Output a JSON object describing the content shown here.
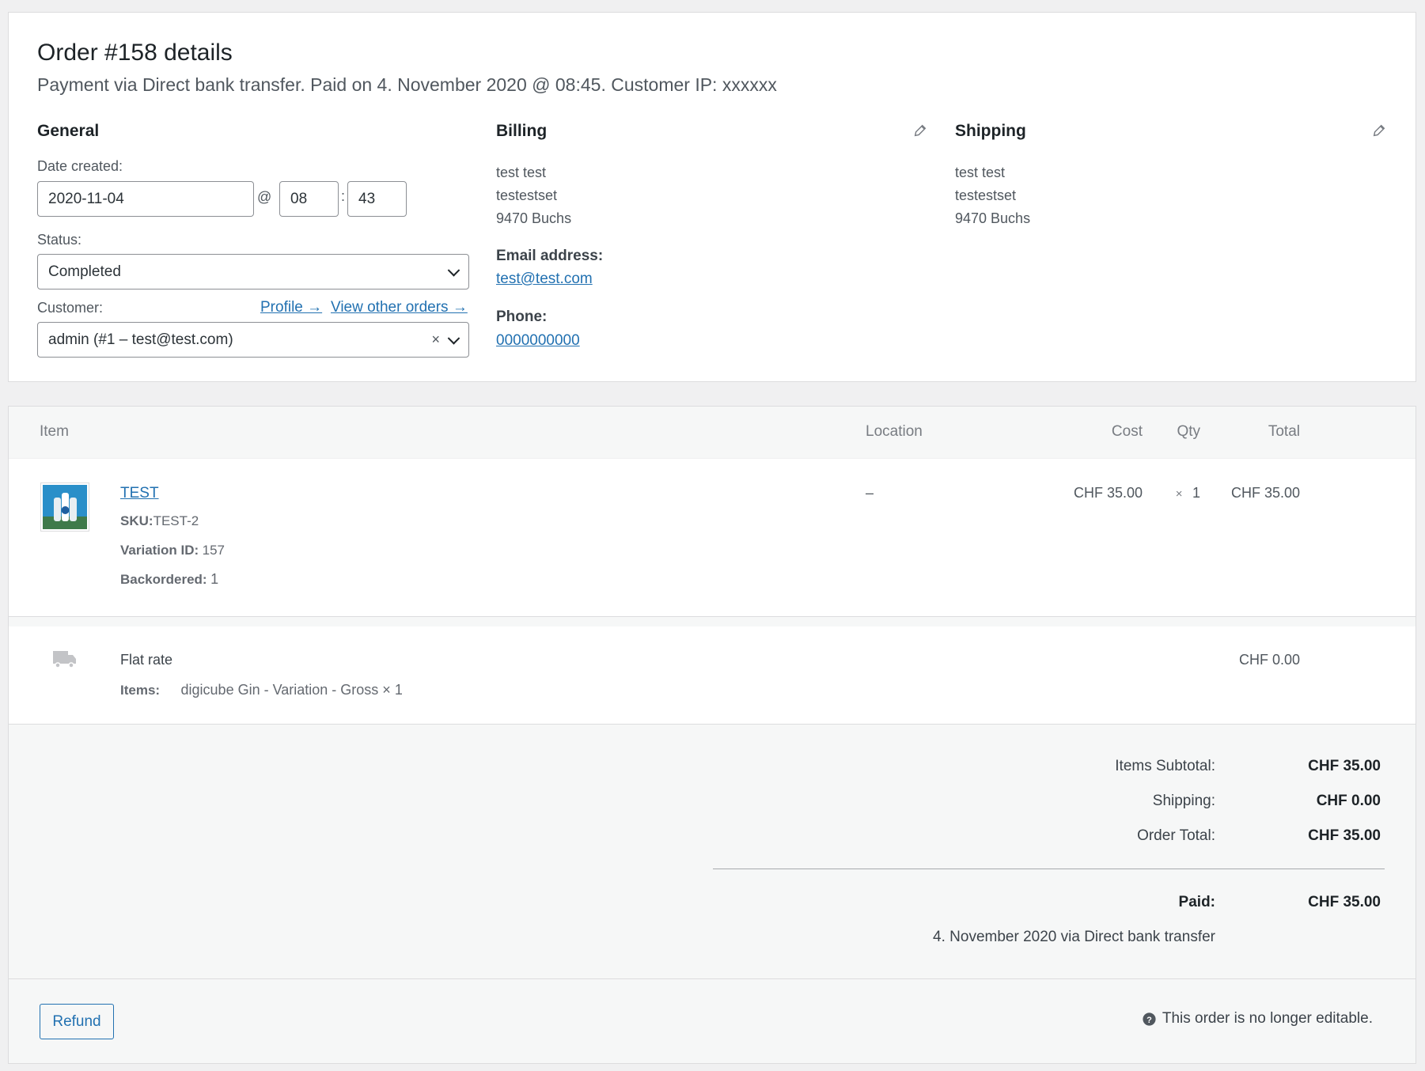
{
  "order": {
    "title": "Order #158 details",
    "subtitle": "Payment via Direct bank transfer. Paid on 4. November 2020 @ 08:45. Customer IP: xxxxxx"
  },
  "general": {
    "heading": "General",
    "date_label": "Date created:",
    "date_value": "2020-11-04",
    "at_sign": "@",
    "hour": "08",
    "colon": ":",
    "minute": "43",
    "status_label": "Status:",
    "status_value": "Completed",
    "customer_label": "Customer:",
    "profile_link": "Profile →",
    "other_orders_link": "View other orders →",
    "customer_value": "admin (#1 – test@test.com)",
    "clear_symbol": "×"
  },
  "billing": {
    "heading": "Billing",
    "line1": "test test",
    "line2": "testestset",
    "line3": "9470 Buchs",
    "email_label": "Email address:",
    "email": "test@test.com",
    "phone_label": "Phone:",
    "phone": "0000000000"
  },
  "shipping": {
    "heading": "Shipping",
    "line1": "test test",
    "line2": "testestset",
    "line3": "9470 Buchs"
  },
  "items_table": {
    "headers": {
      "item": "Item",
      "location": "Location",
      "cost": "Cost",
      "qty": "Qty",
      "total": "Total"
    },
    "item": {
      "name": "TEST",
      "sku_label": "SKU:",
      "sku": "TEST-2",
      "variation_label": "Variation ID:",
      "variation_id": "157",
      "backordered_label": "Backordered:",
      "backordered": "1",
      "location": "–",
      "cost": "CHF 35.00",
      "qty_x": "×",
      "qty": "1",
      "total": "CHF 35.00"
    },
    "shipping_line": {
      "name": "Flat rate",
      "items_label": "Items:",
      "items": "digicube Gin - Variation - Gross × 1",
      "total": "CHF 0.00"
    }
  },
  "totals": {
    "subtotal_label": "Items Subtotal:",
    "subtotal": "CHF 35.00",
    "shipping_label": "Shipping:",
    "shipping": "CHF 0.00",
    "order_total_label": "Order Total:",
    "order_total": "CHF 35.00",
    "paid_label": "Paid:",
    "paid": "CHF 35.00",
    "paid_note": "4. November 2020 via Direct bank transfer"
  },
  "footer": {
    "refund_label": "Refund",
    "not_editable": "This order is no longer editable."
  },
  "colors": {
    "link": "#2271b1",
    "border": "#dcdcde"
  }
}
